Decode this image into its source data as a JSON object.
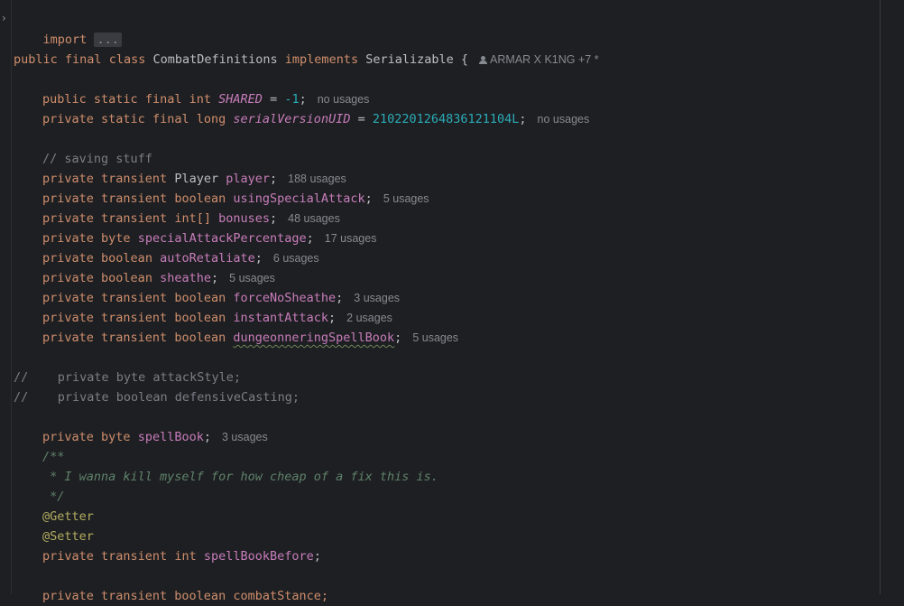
{
  "editor": {
    "import_kw": "import",
    "import_collapsed": "...",
    "class_decl": {
      "public": "public",
      "final": "final",
      "class": "class",
      "name": "CombatDefinitions",
      "implements": "implements",
      "iface": "Serializable",
      "brace": "{",
      "authors": "ARMAR X K1NG +7 *"
    },
    "shared": {
      "public": "public",
      "static": "static",
      "final": "final",
      "type": "int",
      "name": "SHARED",
      "eq": " = ",
      "value": "-1",
      "semi": ";",
      "hint": "no usages"
    },
    "serial": {
      "private": "private",
      "static": "static",
      "final": "final",
      "type": "long",
      "name": "serialVersionUID",
      "eq": " = ",
      "value": "2102201264836121104L",
      "semi": ";",
      "hint": "no usages"
    },
    "comment_saving": "// saving stuff",
    "fields": [
      {
        "mods": "private transient",
        "type": "Player",
        "name": "player",
        "hint": "188 usages"
      },
      {
        "mods": "private transient",
        "type": "boolean",
        "name": "usingSpecialAttack",
        "hint": "5 usages"
      },
      {
        "mods": "private transient",
        "type": "int[]",
        "name": "bonuses",
        "hint": "48 usages"
      },
      {
        "mods": "private",
        "type": "byte",
        "name": "specialAttackPercentage",
        "hint": "17 usages"
      },
      {
        "mods": "private",
        "type": "boolean",
        "name": "autoRetaliate",
        "hint": "6 usages"
      },
      {
        "mods": "private",
        "type": "boolean",
        "name": "sheathe",
        "hint": "5 usages"
      },
      {
        "mods": "private transient",
        "type": "boolean",
        "name": "forceNoSheathe",
        "hint": "3 usages"
      },
      {
        "mods": "private transient",
        "type": "boolean",
        "name": "instantAttack",
        "hint": "2 usages"
      },
      {
        "mods": "private transient",
        "type": "boolean",
        "name": "dungeonneringSpellBook",
        "hint": "5 usages"
      }
    ],
    "commented_1": "//    private byte attackStyle;",
    "commented_2": "//    private boolean defensiveCasting;",
    "spellbook": {
      "mods": "private",
      "type": "byte",
      "name": "spellBook",
      "hint": "3 usages"
    },
    "doc_open": "/**",
    "doc_body": " * I wanna kill myself for how cheap of a fix this is.",
    "doc_close": " */",
    "annotation_getter": "@Getter",
    "annotation_setter": "@Setter",
    "spellbook_before": {
      "mods": "private transient",
      "type": "int",
      "name": "spellBookBefore",
      "semi": ";"
    },
    "partial_line": "private transient boolean combatStance;"
  }
}
